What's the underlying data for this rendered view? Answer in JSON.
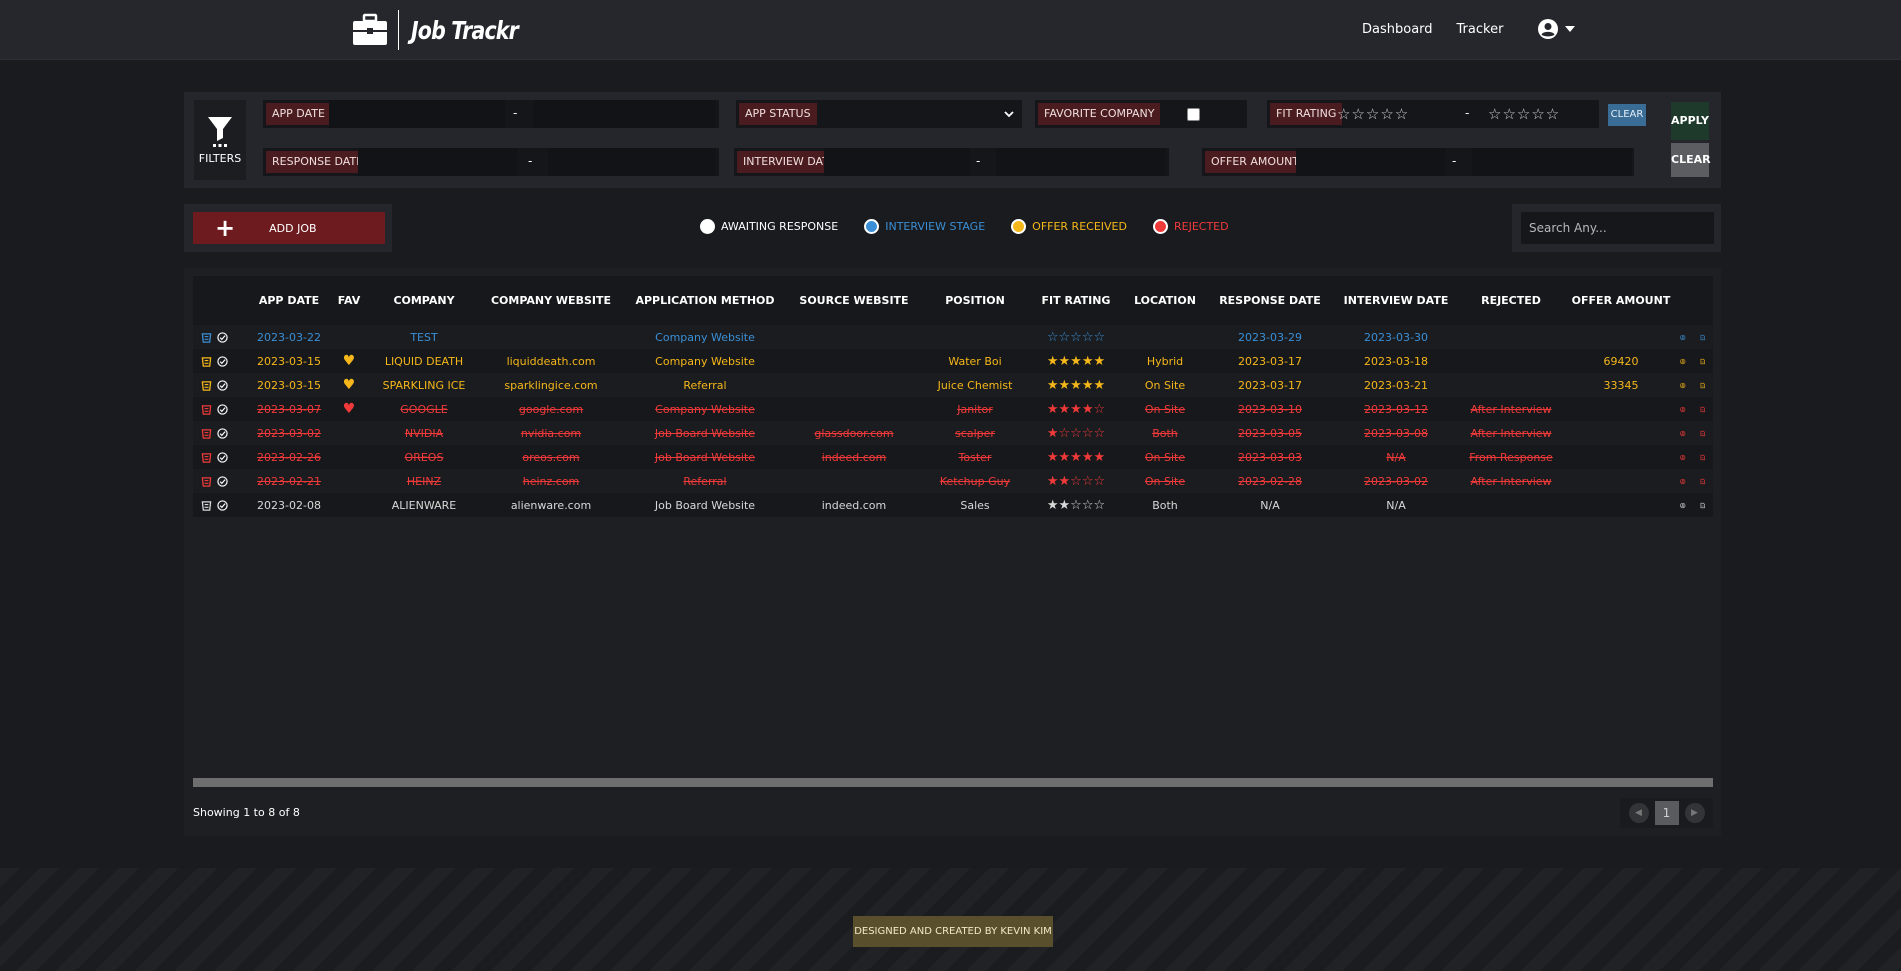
{
  "brand": {
    "title": "Job Trackr",
    "icon": "briefcase-icon"
  },
  "nav": {
    "links": [
      "Dashboard",
      "Tracker"
    ],
    "user_icon": "account-circle-icon"
  },
  "filters": {
    "heading": "FILTERS",
    "app_date": "APP DATE",
    "response_date": "RESPONSE DATE",
    "app_status": "APP STATUS",
    "interview_date": "INTERVIEW DATE",
    "favorite_company": "FAVORITE COMPANY",
    "fit_rating": "FIT RATING",
    "offer_amount": "OFFER AMOUNT",
    "dash": "-",
    "stars_empty": "☆☆☆☆☆",
    "clear_rating": "CLEAR",
    "apply": "APPLY",
    "clear": "CLEAR"
  },
  "actions": {
    "add_job": "ADD JOB",
    "search_placeholder": "Search Any..."
  },
  "legend": [
    {
      "label": "AWAITING RESPONSE",
      "color": "#ffffff"
    },
    {
      "label": "INTERVIEW STAGE",
      "color": "#3a8fd6"
    },
    {
      "label": "OFFER RECEIVED",
      "color": "#f5b71a"
    },
    {
      "label": "REJECTED",
      "color": "#f03a3a"
    }
  ],
  "table": {
    "columns": [
      "",
      "APP DATE",
      "FAV",
      "COMPANY",
      "COMPANY WEBSITE",
      "APPLICATION METHOD",
      "SOURCE WEBSITE",
      "POSITION",
      "FIT RATING",
      "LOCATION",
      "RESPONSE DATE",
      "INTERVIEW DATE",
      "REJECTED",
      "OFFER AMOUNT",
      ""
    ],
    "rows": [
      {
        "status": "blue",
        "app_date": "2023-03-22",
        "fav": "",
        "company": "TEST",
        "website": "",
        "method": "Company Website",
        "source": "",
        "position": "",
        "rating": "☆☆☆☆☆",
        "location": "",
        "response": "2023-03-29",
        "interview": "2023-03-30",
        "rejected": "",
        "offer": ""
      },
      {
        "status": "yellow",
        "app_date": "2023-03-15",
        "fav": "♥",
        "company": "LIQUID DEATH",
        "website": "liquiddeath.com",
        "method": "Company Website",
        "source": "",
        "position": "Water Boi",
        "rating": "★★★★★",
        "location": "Hybrid",
        "response": "2023-03-17",
        "interview": "2023-03-18",
        "rejected": "",
        "offer": "69420"
      },
      {
        "status": "yellow",
        "app_date": "2023-03-15",
        "fav": "♥",
        "company": "SPARKLING ICE",
        "website": "sparklingice.com",
        "method": "Referral",
        "source": "",
        "position": "Juice Chemist",
        "rating": "★★★★★",
        "location": "On Site",
        "response": "2023-03-17",
        "interview": "2023-03-21",
        "rejected": "",
        "offer": "33345"
      },
      {
        "status": "red",
        "app_date": "2023-03-07",
        "fav": "♥",
        "company": "GOOGLE",
        "website": "google.com",
        "method": "Company Website",
        "source": "",
        "position": "Janitor",
        "rating": "★★★★☆",
        "location": "On Site",
        "response": "2023-03-10",
        "interview": "2023-03-12",
        "rejected": "After Interview",
        "offer": ""
      },
      {
        "status": "red",
        "app_date": "2023-03-02",
        "fav": "",
        "company": "NVIDIA",
        "website": "nvidia.com",
        "method": "Job Board Website",
        "source": "glassdoor.com",
        "position": "scalper",
        "rating": "★☆☆☆☆",
        "location": "Both",
        "response": "2023-03-05",
        "interview": "2023-03-08",
        "rejected": "After Interview",
        "offer": ""
      },
      {
        "status": "red",
        "app_date": "2023-02-26",
        "fav": "",
        "company": "OREOS",
        "website": "oreos.com",
        "method": "Job Board Website",
        "source": "indeed.com",
        "position": "Toster",
        "rating": "★★★★★",
        "location": "On Site",
        "response": "2023-03-03",
        "interview": "N/A",
        "rejected": "From Response",
        "offer": ""
      },
      {
        "status": "red",
        "app_date": "2023-02-21",
        "fav": "",
        "company": "HEINZ",
        "website": "heinz.com",
        "method": "Referral",
        "source": "",
        "position": "Ketchup Guy",
        "rating": "★★☆☆☆",
        "location": "On Site",
        "response": "2023-02-28",
        "interview": "2023-03-02",
        "rejected": "After Interview",
        "offer": ""
      },
      {
        "status": "white",
        "app_date": "2023-02-08",
        "fav": "",
        "company": "ALIENWARE",
        "website": "alienware.com",
        "method": "Job Board Website",
        "source": "indeed.com",
        "position": "Sales",
        "rating": "★★☆☆☆",
        "location": "Both",
        "response": "N/A",
        "interview": "N/A",
        "rejected": "",
        "offer": ""
      }
    ]
  },
  "pagination": {
    "showing": "Showing 1 to 8 of 8",
    "page": "1",
    "prev": "◀",
    "next": "▶"
  },
  "footer": {
    "credit": "DESIGNED AND CREATED BY KEVIN KIM"
  },
  "colors": {
    "blue": "#3a8fd6",
    "yellow": "#f5b71a",
    "red": "#f03a3a",
    "white": "#d8d8d8",
    "accent": "#6e1b1f"
  }
}
